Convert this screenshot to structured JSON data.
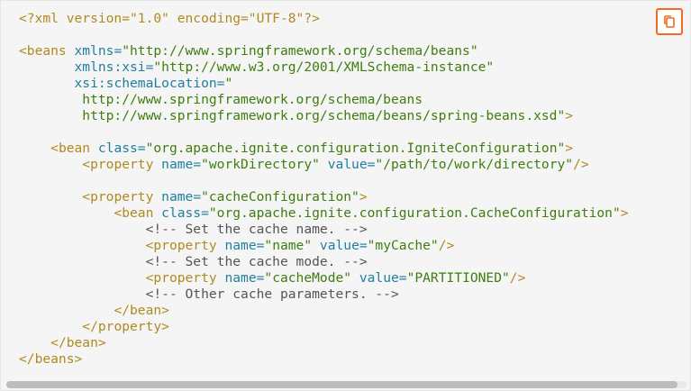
{
  "code_block": {
    "language": "xml",
    "lines": [
      [
        [
          "t-kw",
          "<?xml version=\"1.0\" encoding=\"UTF-8\"?>"
        ]
      ],
      [],
      [
        [
          "t-tag",
          "<beans "
        ],
        [
          "t-attr",
          "xmlns="
        ],
        [
          "t-str",
          "\"http://www.springframework.org/schema/beans\""
        ]
      ],
      [
        [
          "t-plain",
          "       "
        ],
        [
          "t-attr",
          "xmlns:xsi="
        ],
        [
          "t-str",
          "\"http://www.w3.org/2001/XMLSchema-instance\""
        ]
      ],
      [
        [
          "t-plain",
          "       "
        ],
        [
          "t-attr",
          "xsi:schemaLocation="
        ],
        [
          "t-str",
          "\""
        ]
      ],
      [
        [
          "t-str",
          "        http://www.springframework.org/schema/beans"
        ]
      ],
      [
        [
          "t-str",
          "        http://www.springframework.org/schema/beans/spring-beans.xsd\""
        ],
        [
          "t-tag",
          ">"
        ]
      ],
      [],
      [
        [
          "t-plain",
          "    "
        ],
        [
          "t-tag",
          "<bean "
        ],
        [
          "t-attr",
          "class="
        ],
        [
          "t-str",
          "\"org.apache.ignite.configuration.IgniteConfiguration\""
        ],
        [
          "t-tag",
          ">"
        ]
      ],
      [
        [
          "t-plain",
          "        "
        ],
        [
          "t-tag",
          "<property "
        ],
        [
          "t-attr",
          "name="
        ],
        [
          "t-str",
          "\"workDirectory\" "
        ],
        [
          "t-attr",
          "value="
        ],
        [
          "t-str",
          "\"/path/to/work/directory\""
        ],
        [
          "t-tag",
          "/>"
        ]
      ],
      [],
      [
        [
          "t-plain",
          "        "
        ],
        [
          "t-tag",
          "<property "
        ],
        [
          "t-attr",
          "name="
        ],
        [
          "t-str",
          "\"cacheConfiguration\""
        ],
        [
          "t-tag",
          ">"
        ]
      ],
      [
        [
          "t-plain",
          "            "
        ],
        [
          "t-tag",
          "<bean "
        ],
        [
          "t-attr",
          "class="
        ],
        [
          "t-str",
          "\"org.apache.ignite.configuration.CacheConfiguration\""
        ],
        [
          "t-tag",
          ">"
        ]
      ],
      [
        [
          "t-plain",
          "                "
        ],
        [
          "t-com",
          "<!-- Set the cache name. -->"
        ]
      ],
      [
        [
          "t-plain",
          "                "
        ],
        [
          "t-tag",
          "<property "
        ],
        [
          "t-attr",
          "name="
        ],
        [
          "t-str",
          "\"name\" "
        ],
        [
          "t-attr",
          "value="
        ],
        [
          "t-str",
          "\"myCache\""
        ],
        [
          "t-tag",
          "/>"
        ]
      ],
      [
        [
          "t-plain",
          "                "
        ],
        [
          "t-com",
          "<!-- Set the cache mode. -->"
        ]
      ],
      [
        [
          "t-plain",
          "                "
        ],
        [
          "t-tag",
          "<property "
        ],
        [
          "t-attr",
          "name="
        ],
        [
          "t-str",
          "\"cacheMode\" "
        ],
        [
          "t-attr",
          "value="
        ],
        [
          "t-str",
          "\"PARTITIONED\""
        ],
        [
          "t-tag",
          "/>"
        ]
      ],
      [
        [
          "t-plain",
          "                "
        ],
        [
          "t-com",
          "<!-- Other cache parameters. -->"
        ]
      ],
      [
        [
          "t-plain",
          "            "
        ],
        [
          "t-tag",
          "</bean>"
        ]
      ],
      [
        [
          "t-plain",
          "        "
        ],
        [
          "t-tag",
          "</property>"
        ]
      ],
      [
        [
          "t-plain",
          "    "
        ],
        [
          "t-tag",
          "</bean>"
        ]
      ],
      [
        [
          "t-tag",
          "</beans>"
        ]
      ]
    ]
  },
  "copy_button": {
    "icon": "copy-icon",
    "border_color": "#f26b21"
  },
  "colors": {
    "tag": "#b08a1f",
    "attribute": "#1f7f9e",
    "string": "#3e7d0e",
    "comment": "#555555",
    "background": "#f5f5f5"
  }
}
